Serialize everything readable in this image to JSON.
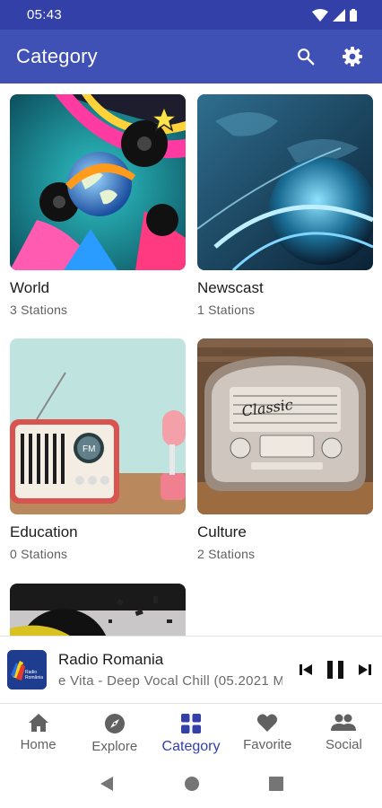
{
  "status_bar": {
    "time": "05:43"
  },
  "app_bar": {
    "title": "Category"
  },
  "categories": [
    {
      "name": "World",
      "count": "3 Stations"
    },
    {
      "name": "Newscast",
      "count": "1 Stations"
    },
    {
      "name": "Education",
      "count": "0 Stations"
    },
    {
      "name": "Culture",
      "count": "2 Stations"
    },
    {
      "name": "",
      "count": ""
    }
  ],
  "player": {
    "station": "Radio Romania",
    "track": "e Vita - Deep Vocal Chill (05.2021 Mi"
  },
  "bottom_nav": {
    "items": [
      {
        "label": "Home",
        "icon": "home-icon"
      },
      {
        "label": "Explore",
        "icon": "compass-icon"
      },
      {
        "label": "Category",
        "icon": "grid-icon"
      },
      {
        "label": "Favorite",
        "icon": "heart-icon"
      },
      {
        "label": "Social",
        "icon": "people-icon"
      }
    ],
    "active_index": 2
  },
  "colors": {
    "primary": "#3f51b5",
    "status_bar": "#3340a8",
    "active_nav": "#3340a8"
  }
}
